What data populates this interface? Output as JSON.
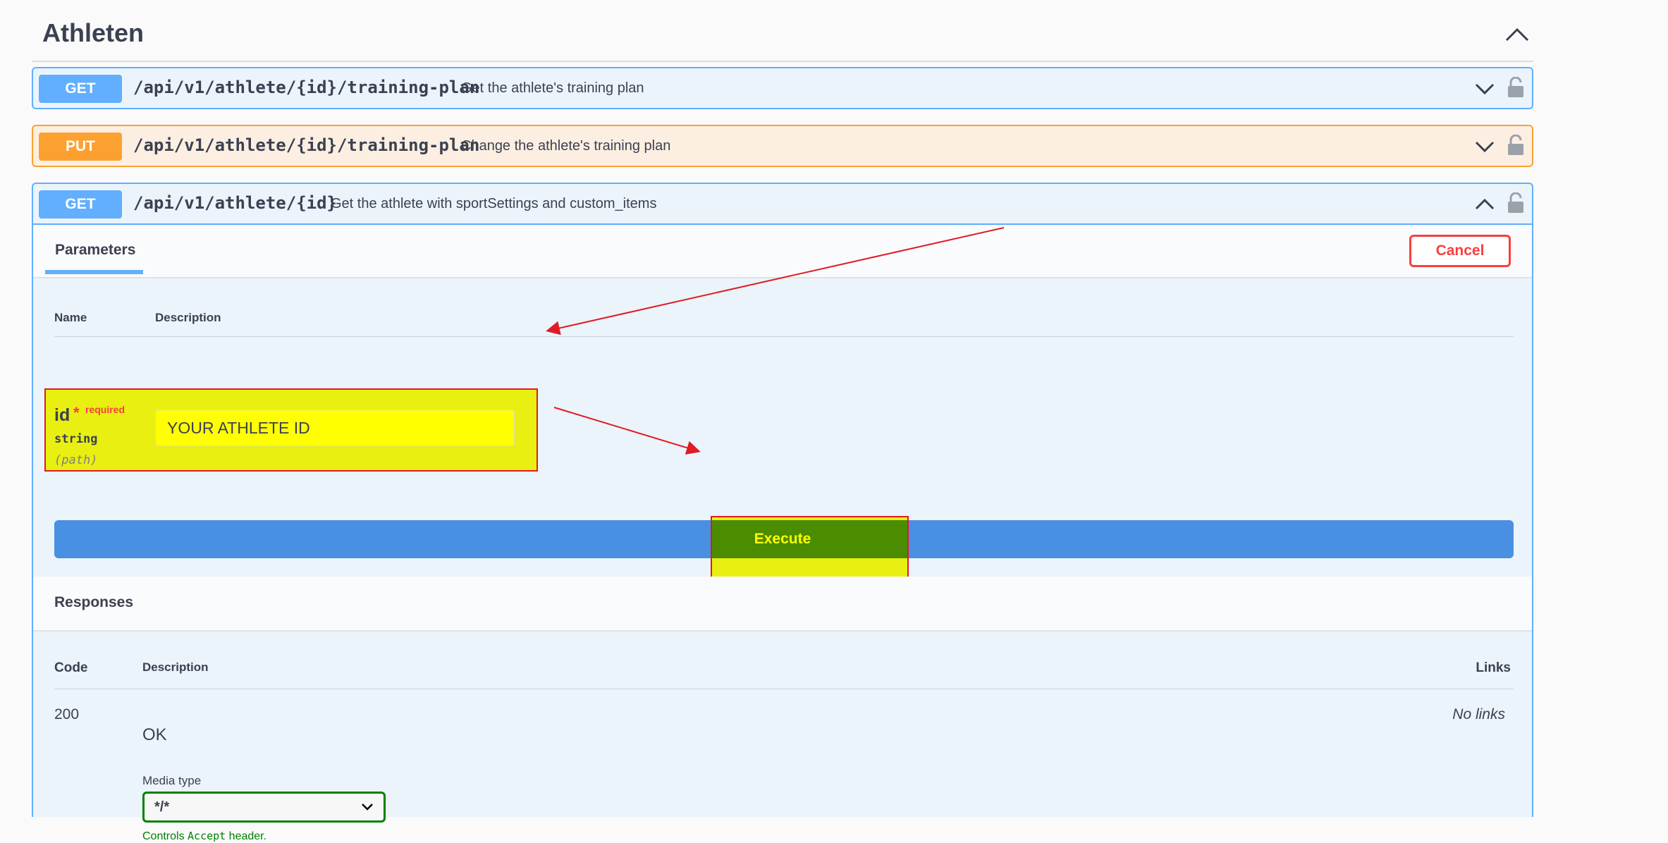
{
  "section": {
    "title": "Athleten",
    "toggle_icon": "chevron-up-icon"
  },
  "operations": [
    {
      "method": "GET",
      "path": "/api/v1/athlete/{id}/training-plan",
      "description": "Get the athlete's training plan",
      "expanded": false
    },
    {
      "method": "PUT",
      "path": "/api/v1/athlete/{id}/training-plan",
      "description": "Change the athlete's training plan",
      "expanded": false
    },
    {
      "method": "GET",
      "path": "/api/v1/athlete/{id}",
      "description": "Get the athlete with sportSettings and custom_items",
      "expanded": true
    }
  ],
  "expanded_op": {
    "tab_label": "Parameters",
    "cancel_label": "Cancel",
    "param_columns": {
      "name": "Name",
      "description": "Description"
    },
    "param": {
      "name": "id",
      "star": "*",
      "required_label": "required",
      "type": "string",
      "location": "(path)",
      "value": "YOUR ATHLETE ID"
    },
    "execute_label": "Execute",
    "responses": {
      "title": "Responses",
      "columns": {
        "code": "Code",
        "description": "Description",
        "links": "Links"
      },
      "rows": [
        {
          "code": "200",
          "description": "OK",
          "links": "No links",
          "media_type_label": "Media type",
          "media_type_value": "*/*",
          "hint_prefix": "Controls ",
          "hint_code": "Accept",
          "hint_suffix": " header."
        }
      ]
    }
  },
  "colors": {
    "get": "#61affe",
    "put": "#fca130",
    "execute": "#4990e2",
    "cancel": "#f93e3e",
    "highlight": "#e9ef10",
    "annotation": "#e01b24"
  }
}
